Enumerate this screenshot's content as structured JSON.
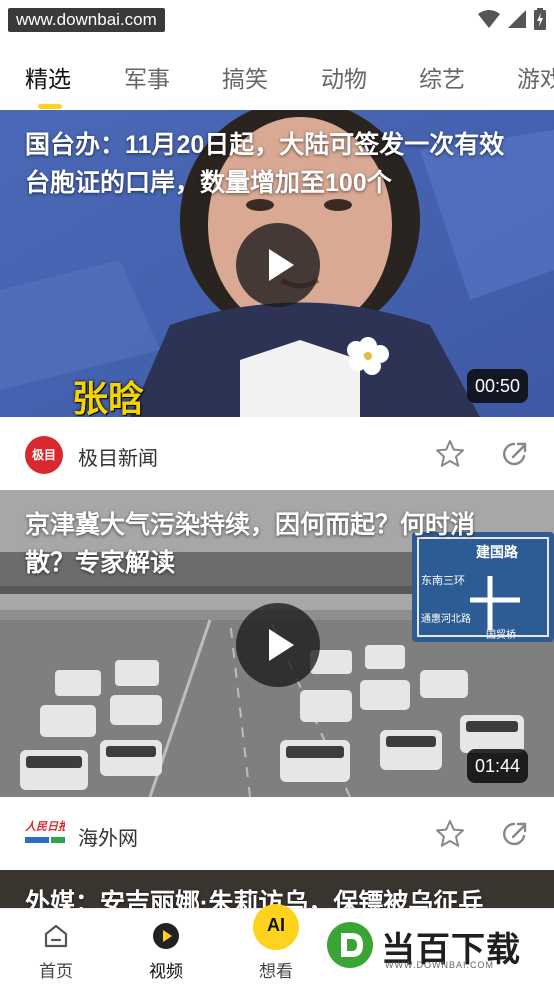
{
  "status_bar": {
    "watermark_url": "www.downbai.com"
  },
  "tabs": [
    {
      "label": "精选",
      "active": true
    },
    {
      "label": "军事",
      "active": false
    },
    {
      "label": "搞笑",
      "active": false
    },
    {
      "label": "动物",
      "active": false
    },
    {
      "label": "综艺",
      "active": false
    },
    {
      "label": "游戏",
      "active": false
    }
  ],
  "feed": [
    {
      "title": "国台办：11月20日起，大陆可签发一次有效台胞证的口岸，数量增加至100个",
      "duration": "00:50",
      "caption_overlay": "张晗",
      "source": "极目新闻",
      "logo_text": "极目",
      "thumbnail": "news-anchor"
    },
    {
      "title": "京津冀大气污染持续，因何而起？何时消散？专家解读",
      "duration": "01:44",
      "sign_text": [
        "建国路",
        "东南三环",
        "通惠河北路",
        "国贸桥"
      ],
      "source": "海外网",
      "logo_text": "人民日报",
      "thumbnail": "smoggy-traffic"
    },
    {
      "title": "外媒：安吉丽娜·朱莉访乌，保镖被乌征兵"
    }
  ],
  "bottom_nav": [
    {
      "label": "首页",
      "icon": "home-icon"
    },
    {
      "label": "视频",
      "icon": "video-play-icon"
    },
    {
      "label": "想看",
      "icon": "ai-icon",
      "badge": "AI"
    }
  ],
  "watermark": {
    "text": "当百下载",
    "sub": "WWW.DOWNBAI.COM"
  },
  "colors": {
    "accent": "#ffd21e",
    "source_red": "#d9282f"
  }
}
